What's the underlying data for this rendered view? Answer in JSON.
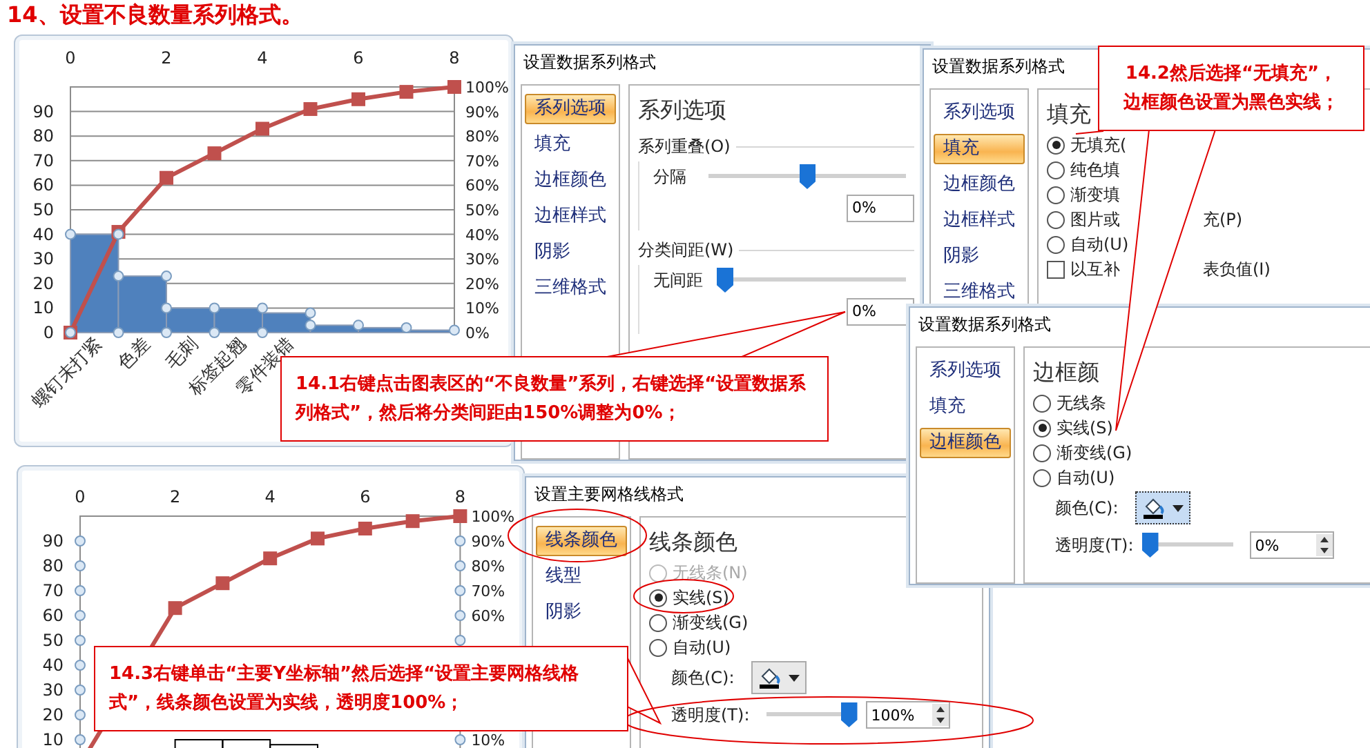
{
  "title": "14、设置不良数量系列格式。",
  "charts": [
    {
      "bars_selected": true,
      "axis_selected": false,
      "bars_filled": true,
      "category_labels": [
        "螺钉未打紧",
        "色差",
        "毛刺",
        "标签起翘",
        "零件装错"
      ],
      "right_axis_labels": [
        "100%",
        "90%",
        "80%",
        "70%",
        "60%",
        "50%",
        "40%",
        "30%",
        "20%",
        "10%",
        "0%"
      ],
      "chart_data": {
        "type": "bar",
        "x": [
          0,
          0.5,
          1,
          1.5,
          2,
          2.5,
          3,
          3.5,
          4,
          4.5,
          5,
          5.5,
          6,
          6.5,
          7,
          7.5,
          8
        ],
        "xlim": [
          0,
          8
        ],
        "xticks": [
          0,
          2,
          4,
          6,
          8
        ],
        "yticks": [
          0,
          10,
          20,
          30,
          40,
          50,
          60,
          70,
          80,
          90
        ],
        "ylim": [
          0,
          100
        ],
        "grid": true,
        "series": [
          {
            "type": "bar",
            "color": "#4f81bd",
            "values": [
              null,
              40,
              null,
              23,
              null,
              10,
              null,
              10,
              null,
              8,
              null,
              3,
              null,
              2,
              null,
              1,
              null
            ]
          },
          {
            "type": "line",
            "marker": "square",
            "color": "#c0504d",
            "values": [
              0,
              null,
              41,
              null,
              63,
              null,
              73,
              null,
              83,
              null,
              91,
              null,
              95,
              null,
              98,
              null,
              100
            ]
          }
        ]
      }
    },
    {
      "bars_selected": false,
      "axis_selected": true,
      "bars_filled": false,
      "right_axis_labels": [
        "100%",
        "90%",
        "80%",
        "70%",
        "60%"
      ],
      "right_axis_bottom_labels": [
        "10%"
      ],
      "chart_data": {
        "type": "bar",
        "x": [
          0,
          0.5,
          1,
          1.5,
          2,
          2.5,
          3,
          3.5,
          4,
          4.5,
          5,
          5.5,
          6,
          6.5,
          7,
          7.5,
          8
        ],
        "xlim": [
          0,
          8
        ],
        "xticks": [
          0,
          2,
          4,
          6,
          8
        ],
        "yticks": [
          10,
          20,
          30,
          40,
          50,
          60,
          70,
          80,
          90
        ],
        "ylim": [
          0,
          100
        ],
        "grid": false,
        "series": [
          {
            "type": "bar",
            "color": "#000000",
            "values": [
              null,
              null,
              null,
              null,
              null,
              10,
              null,
              10,
              null,
              8,
              null,
              null,
              null,
              null,
              null,
              null,
              null
            ]
          },
          {
            "type": "line",
            "marker": "square",
            "color": "#c0504d",
            "values": [
              0,
              null,
              null,
              null,
              63,
              null,
              73,
              null,
              83,
              null,
              91,
              null,
              95,
              null,
              98,
              null,
              100
            ]
          }
        ]
      }
    }
  ],
  "dialogs": [
    {
      "title": "设置数据系列格式",
      "nav": [
        {
          "label": "系列选项",
          "selected": true
        },
        {
          "label": "填充",
          "selected": false
        },
        {
          "label": "边框颜色",
          "selected": false
        },
        {
          "label": "边框样式",
          "selected": false
        },
        {
          "label": "阴影",
          "selected": false
        },
        {
          "label": "三维格式",
          "selected": false
        }
      ],
      "heading": "系列选项",
      "content": [
        {
          "kind": "group",
          "label": "系列重叠(O)"
        },
        {
          "kind": "slider",
          "label": "分隔",
          "level": 0.5,
          "value": "0%"
        },
        {
          "kind": "group",
          "label": "分类间距(W)"
        },
        {
          "kind": "slider",
          "label": "无间距",
          "level": 0,
          "value": "0%"
        }
      ]
    },
    {
      "title": "设置数据系列格式",
      "nav": [
        {
          "label": "系列选项",
          "selected": false
        },
        {
          "label": "填充",
          "selected": true
        },
        {
          "label": "边框颜色",
          "selected": false
        },
        {
          "label": "边框样式",
          "selected": false
        },
        {
          "label": "阴影",
          "selected": false
        },
        {
          "label": "三维格式",
          "selected": false
        }
      ],
      "heading": "填充",
      "content": [
        {
          "kind": "radio",
          "label": "无填充(",
          "selected": true
        },
        {
          "kind": "radio",
          "label": "纯色填",
          "selected": false
        },
        {
          "kind": "radio",
          "label": "渐变填",
          "selected": false
        },
        {
          "kind": "radio",
          "label": "图片或",
          "tail": "充(P)",
          "selected": false
        },
        {
          "kind": "radio",
          "label": "自动(U)",
          "selected": false
        },
        {
          "kind": "checkbox",
          "label": "以互补",
          "tail": "表负值(I)",
          "checked": false
        }
      ]
    },
    {
      "title": "设置数据系列格式",
      "nav": [
        {
          "label": "系列选项",
          "selected": false
        },
        {
          "label": "填充",
          "selected": false
        },
        {
          "label": "边框颜色",
          "selected": true
        }
      ],
      "heading": "边框颜",
      "content": [
        {
          "kind": "radio",
          "label": "无线条",
          "selected": false
        },
        {
          "kind": "radio",
          "label": "实线(S)",
          "selected": true
        },
        {
          "kind": "radio",
          "label": "渐变线(G)",
          "selected": false
        },
        {
          "kind": "radio",
          "label": "自动(U)",
          "selected": false
        },
        {
          "kind": "color",
          "label": "颜色(C):",
          "focused": true
        },
        {
          "kind": "transparency",
          "label": "透明度(T):",
          "level": 0,
          "value": "0%"
        }
      ]
    },
    {
      "title": "设置主要网格线格式",
      "nav": [
        {
          "label": "线条颜色",
          "selected": true
        },
        {
          "label": "线型",
          "selected": false
        },
        {
          "label": "阴影",
          "selected": false
        }
      ],
      "heading": "线条颜色",
      "content": [
        {
          "kind": "radio",
          "label": "无线条(N)",
          "selected": false,
          "disabled": true
        },
        {
          "kind": "radio",
          "label": "实线(S)",
          "selected": true,
          "disabled": false
        },
        {
          "kind": "radio",
          "label": "渐变线(G)",
          "selected": false,
          "disabled": false
        },
        {
          "kind": "radio",
          "label": "自动(U)",
          "selected": false,
          "disabled": false
        },
        {
          "kind": "color",
          "label": "颜色(C):",
          "focused": false
        },
        {
          "kind": "transparency",
          "label": "透明度(T):",
          "level": 1,
          "value": "100%"
        }
      ]
    }
  ],
  "callouts": [
    {
      "text": "14.1右键点击图表区的“不良数量”系列，右键选择“设置数据系列格式”，然后将分类间距由150%调整为0%；"
    },
    {
      "text": "14.2然后选择“无填充”，边框颜色设置为黑色实线；"
    },
    {
      "text": "14.3右键单击“主要Y坐标轴”然后选择“设置主要网格线格式”，线条颜色设置为实线，透明度100%；"
    }
  ]
}
